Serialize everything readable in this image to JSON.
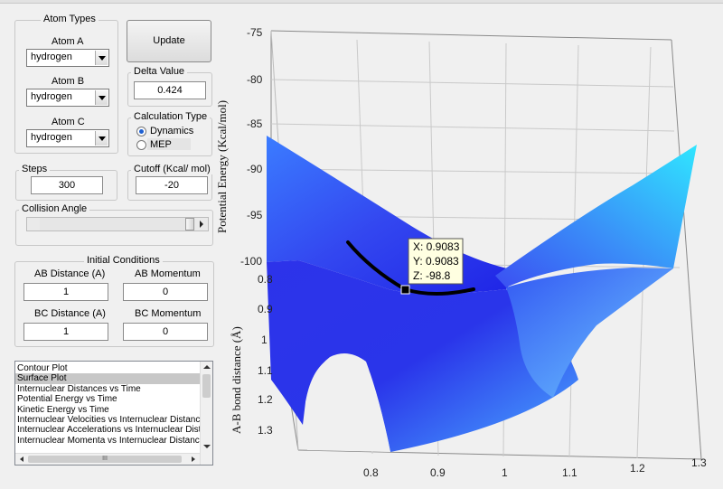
{
  "atom_types": {
    "title": "Atom Types",
    "atom_a_label": "Atom A",
    "atom_a_value": "hydrogen",
    "atom_b_label": "Atom B",
    "atom_b_value": "hydrogen",
    "atom_c_label": "Atom C",
    "atom_c_value": "hydrogen"
  },
  "update_button": "Update",
  "delta": {
    "title": "Delta Value",
    "value": "0.424"
  },
  "calc_type": {
    "title": "Calculation Type",
    "options": [
      "Dynamics",
      "MEP"
    ],
    "selected": "Dynamics"
  },
  "steps": {
    "title": "Steps",
    "value": "300"
  },
  "cutoff": {
    "title": "Cutoff (Kcal/ mol)",
    "value": "-20"
  },
  "collision": {
    "title": "Collision Angle",
    "value_fraction": 0.98
  },
  "initial_conditions": {
    "title": "Initial Conditions",
    "ab_distance_label": "AB Distance (A)",
    "ab_distance_value": "1",
    "ab_momentum_label": "AB Momentum",
    "ab_momentum_value": "0",
    "bc_distance_label": "BC Distance (A)",
    "bc_distance_value": "1",
    "bc_momentum_label": "BC Momentum",
    "bc_momentum_value": "0"
  },
  "plot_list": {
    "items": [
      "Contour Plot",
      "Surface Plot",
      "Internuclear Distances vs Time",
      "Potential Energy vs Time",
      "Kinetic Energy vs Time",
      "Internuclear Velocities vs Internuclear Distance",
      "Internuclear Accelerations vs Internuclear Distance",
      "Internuclear Momenta vs Internuclear Distance"
    ],
    "selected": "Surface Plot",
    "hscroll_grip": "III"
  },
  "plot": {
    "z_axis_label": "Potential Energy (Kcal/mol)",
    "y_axis_label": "A-B bond distance (Å)",
    "z_ticks": [
      "-75",
      "-80",
      "-85",
      "-90",
      "-95",
      "-100"
    ],
    "y_ticks": [
      "0.8",
      "0.9",
      "1",
      "1.1",
      "1.2",
      "1.3"
    ],
    "x_ticks": [
      "0.8",
      "0.9",
      "1",
      "1.1",
      "1.2",
      "1.3"
    ],
    "colors": {
      "surface_dark": "#2323e8",
      "surface_mid": "#3a6df5",
      "surface_light": "#31e3ff",
      "trajectory": "#000000"
    },
    "datatip": {
      "x": "X: 0.9083",
      "y": "Y: 0.9083",
      "z": "Z: -98.8"
    }
  }
}
